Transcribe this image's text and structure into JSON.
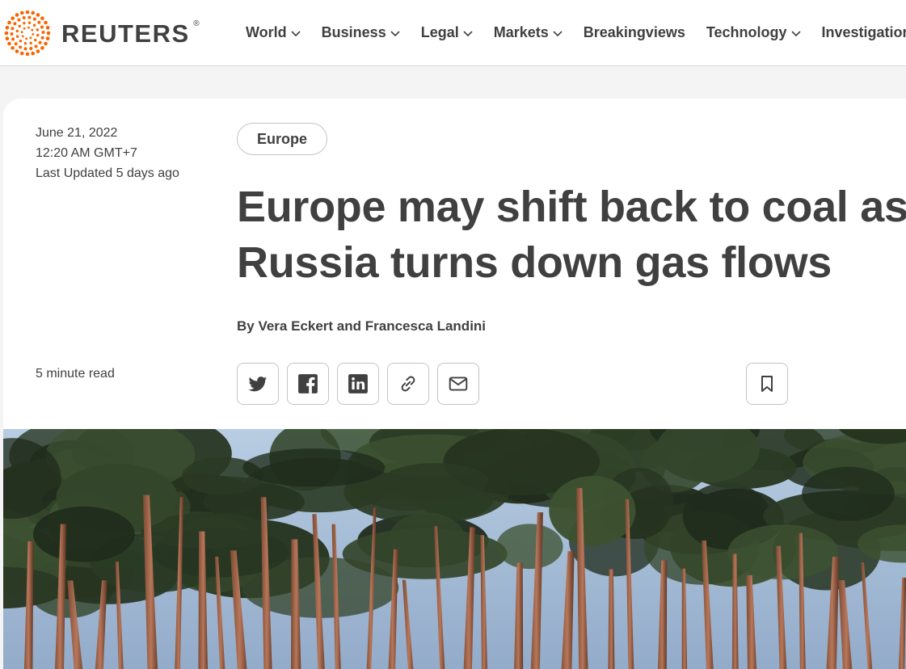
{
  "brand": {
    "name": "REUTERS",
    "registered": "®",
    "accent": "#fa6400"
  },
  "nav": [
    {
      "label": "World",
      "dropdown": true
    },
    {
      "label": "Business",
      "dropdown": true
    },
    {
      "label": "Legal",
      "dropdown": true
    },
    {
      "label": "Markets",
      "dropdown": true
    },
    {
      "label": "Breakingviews",
      "dropdown": false
    },
    {
      "label": "Technology",
      "dropdown": true
    },
    {
      "label": "Investigations",
      "dropdown": false
    }
  ],
  "article": {
    "date": "June 21, 2022",
    "time": "12:20 AM GMT+7",
    "updated": "Last Updated 5 days ago",
    "read_time": "5 minute read",
    "tag": "Europe",
    "headline": "Europe may shift back to coal as Russia turns down gas flows",
    "byline": "By Vera Eckert and Francesca Landini"
  },
  "share_icons": [
    "twitter-icon",
    "facebook-icon",
    "linkedin-icon",
    "link-icon",
    "email-icon"
  ],
  "colors": {
    "text": "#404040",
    "border": "#c4c4c4",
    "sky": "#a9bfd8"
  }
}
